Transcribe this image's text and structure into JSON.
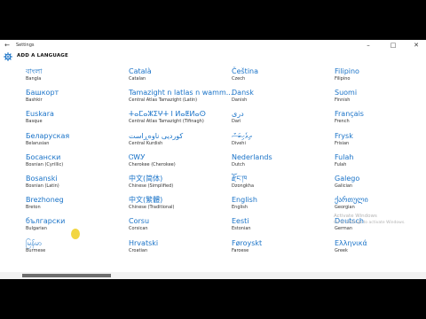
{
  "window": {
    "title": "Settings"
  },
  "header": {
    "title": "ADD A LANGUAGE"
  },
  "icons": {
    "back": "back-arrow-icon",
    "settings": "gear-icon"
  },
  "colors": {
    "accent": "#1a73c8",
    "background": "#ffffff",
    "letterbox": "#000000"
  },
  "languages": [
    [
      {
        "native": "বাংলা",
        "english": "Bangla"
      },
      {
        "native": "Башкорт",
        "english": "Bashkir"
      },
      {
        "native": "Euskara",
        "english": "Basque"
      },
      {
        "native": "Беларуская",
        "english": "Belarusian"
      },
      {
        "native": "Босански",
        "english": "Bosnian (Cyrillic)"
      },
      {
        "native": "Bosanski",
        "english": "Bosnian (Latin)"
      },
      {
        "native": "Brezhoneg",
        "english": "Breton"
      },
      {
        "native": "български",
        "english": "Bulgarian"
      },
      {
        "native": "မြန်မာ",
        "english": "Burmese"
      }
    ],
    [
      {
        "native": "Català",
        "english": "Catalan"
      },
      {
        "native": "Tamazight n latlas n wamm...",
        "english": "Central Atlas Tamazight (Latin)"
      },
      {
        "native": "ⵜⴰⵎⴰⵣⵉⵖⵜ ⵏ ⵍⴰⵟⵍⴰⵙ",
        "english": "Central Atlas Tamazight (Tifinagh)"
      },
      {
        "native": "کوردیی ناوەڕاست",
        "english": "Central Kurdish"
      },
      {
        "native": "ᏣᎳᎩ",
        "english": "Cherokee (Cherokee)"
      },
      {
        "native": "中文(简体)",
        "english": "Chinese (Simplified)"
      },
      {
        "native": "中文(繁體)",
        "english": "Chinese (Traditional)"
      },
      {
        "native": "Corsu",
        "english": "Corsican"
      },
      {
        "native": "Hrvatski",
        "english": "Croatian"
      }
    ],
    [
      {
        "native": "Čeština",
        "english": "Czech"
      },
      {
        "native": "Dansk",
        "english": "Danish"
      },
      {
        "native": "دری",
        "english": "Dari"
      },
      {
        "native": "ދިވެހިބަސް",
        "english": "Divehi"
      },
      {
        "native": "Nederlands",
        "english": "Dutch"
      },
      {
        "native": "རྫོང་ཁ",
        "english": "Dzongkha"
      },
      {
        "native": "English",
        "english": "English"
      },
      {
        "native": "Eesti",
        "english": "Estonian"
      },
      {
        "native": "Føroyskt",
        "english": "Faroese"
      }
    ],
    [
      {
        "native": "Filipino",
        "english": "Filipino"
      },
      {
        "native": "Suomi",
        "english": "Finnish"
      },
      {
        "native": "Français",
        "english": "French"
      },
      {
        "native": "Frysk",
        "english": "Frisian"
      },
      {
        "native": "Fulah",
        "english": "Fulah"
      },
      {
        "native": "Galego",
        "english": "Galician"
      },
      {
        "native": "ქართული",
        "english": "Georgian"
      },
      {
        "native": "Deutsch",
        "english": "German"
      },
      {
        "native": "Ελληνικά",
        "english": "Greek"
      }
    ]
  ],
  "watermark": {
    "line1": "Activate Windows",
    "line2": "Go to Settings to activate Windows."
  }
}
